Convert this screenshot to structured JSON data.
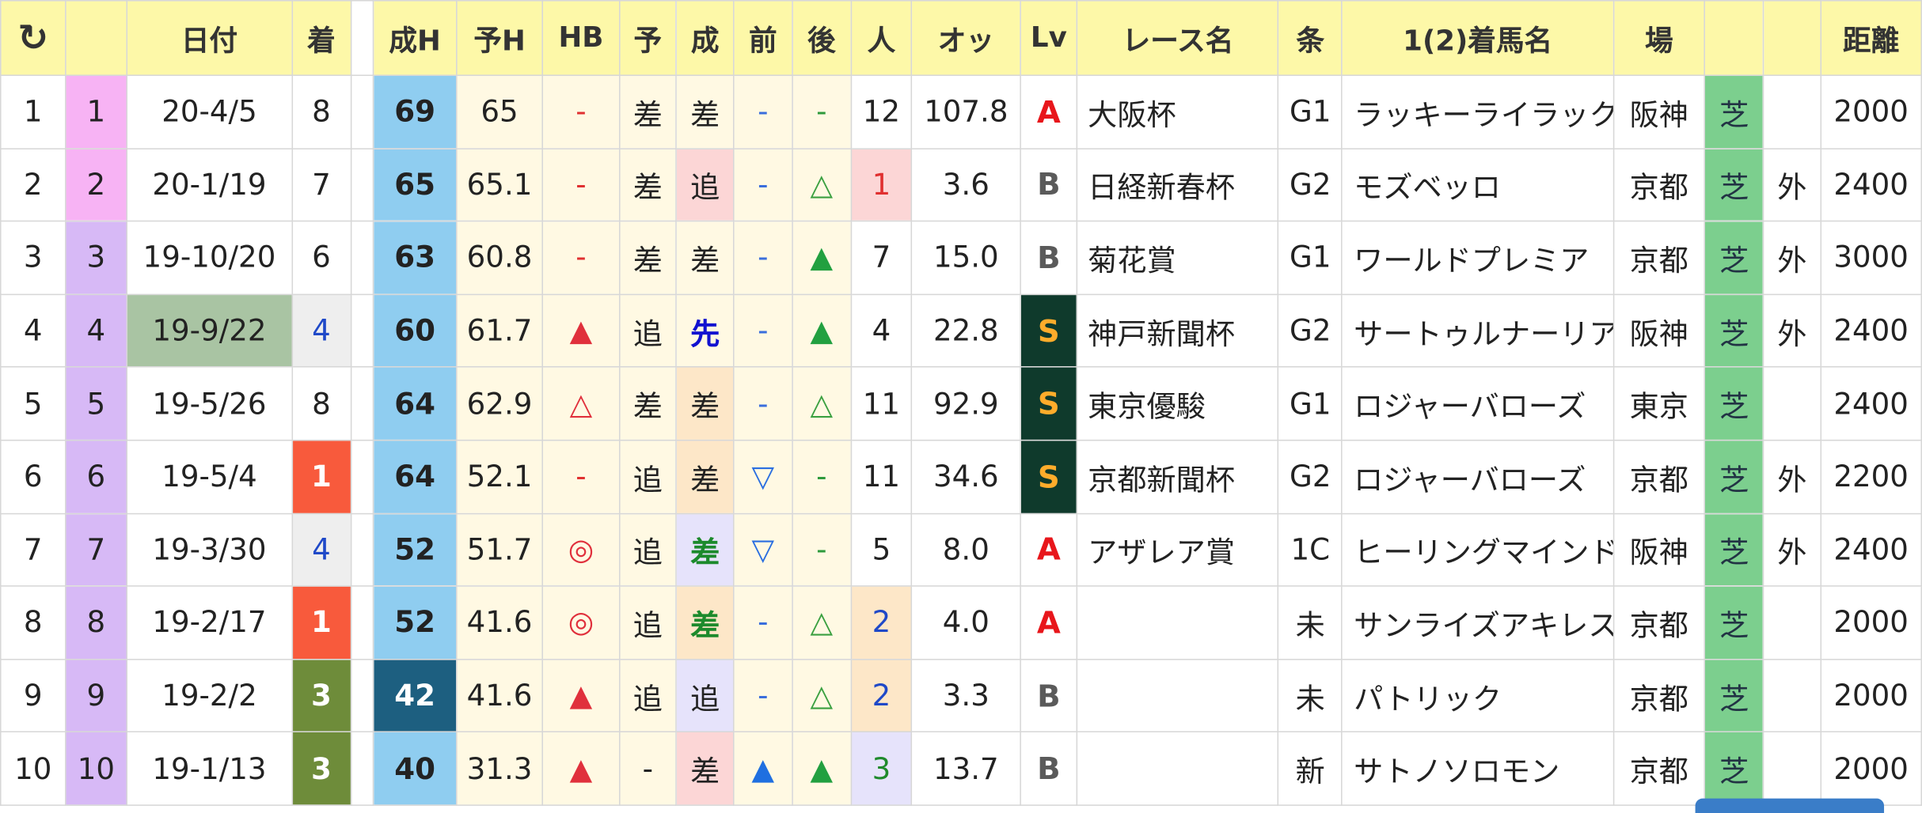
{
  "headers": {
    "refresh_icon": "refresh-icon",
    "date": "日付",
    "finish": "着",
    "actual_h": "成H",
    "pred_h": "予H",
    "hb": "HB",
    "pred_style": "予",
    "actual_style": "成",
    "front": "前",
    "back": "後",
    "popularity": "人",
    "odds": "オッ",
    "lv": "Lv",
    "race_name": "レース名",
    "cond": "条",
    "winner": "1(2)着馬名",
    "venue": "場",
    "distance": "距離"
  },
  "rows": [
    {
      "idx": "1",
      "no": "1",
      "date": "20-4/5",
      "finish": "8",
      "ah": "69",
      "ph": "65",
      "hb": "-",
      "ps": "差",
      "as": "差",
      "fr": "-",
      "bk": "-",
      "pop": "12",
      "odds": "107.8",
      "lv": "A",
      "race": "大阪杯",
      "cond": "G1",
      "horse": "ラッキーライラック",
      "venue": "阪神",
      "surface": "芝",
      "course": "",
      "dist": "2000"
    },
    {
      "idx": "2",
      "no": "2",
      "date": "20-1/19",
      "finish": "7",
      "ah": "65",
      "ph": "65.1",
      "hb": "-",
      "ps": "差",
      "as": "追",
      "fr": "-",
      "bk": "△",
      "pop": "1",
      "odds": "3.6",
      "lv": "B",
      "race": "日経新春杯",
      "cond": "G2",
      "horse": "モズベッロ",
      "venue": "京都",
      "surface": "芝",
      "course": "外",
      "dist": "2400"
    },
    {
      "idx": "3",
      "no": "3",
      "date": "19-10/20",
      "finish": "6",
      "ah": "63",
      "ph": "60.8",
      "hb": "-",
      "ps": "差",
      "as": "差",
      "fr": "-",
      "bk": "▲",
      "pop": "7",
      "odds": "15.0",
      "lv": "B",
      "race": "菊花賞",
      "cond": "G1",
      "horse": "ワールドプレミア",
      "venue": "京都",
      "surface": "芝",
      "course": "外",
      "dist": "3000"
    },
    {
      "idx": "4",
      "no": "4",
      "date": "19-9/22",
      "finish": "4",
      "ah": "60",
      "ph": "61.7",
      "hb": "▲",
      "ps": "追",
      "as": "先",
      "fr": "-",
      "bk": "▲",
      "pop": "4",
      "odds": "22.8",
      "lv": "S",
      "race": "神戸新聞杯",
      "cond": "G2",
      "horse": "サートゥルナーリア",
      "venue": "阪神",
      "surface": "芝",
      "course": "外",
      "dist": "2400"
    },
    {
      "idx": "5",
      "no": "5",
      "date": "19-5/26",
      "finish": "8",
      "ah": "64",
      "ph": "62.9",
      "hb": "△",
      "ps": "差",
      "as": "差",
      "fr": "-",
      "bk": "△",
      "pop": "11",
      "odds": "92.9",
      "lv": "S",
      "race": "東京優駿",
      "cond": "G1",
      "horse": "ロジャーバローズ",
      "venue": "東京",
      "surface": "芝",
      "course": "",
      "dist": "2400"
    },
    {
      "idx": "6",
      "no": "6",
      "date": "19-5/4",
      "finish": "1",
      "ah": "64",
      "ph": "52.1",
      "hb": "-",
      "ps": "追",
      "as": "差",
      "fr": "▽",
      "bk": "-",
      "pop": "11",
      "odds": "34.6",
      "lv": "S",
      "race": "京都新聞杯",
      "cond": "G2",
      "horse": "ロジャーバローズ",
      "venue": "京都",
      "surface": "芝",
      "course": "外",
      "dist": "2200"
    },
    {
      "idx": "7",
      "no": "7",
      "date": "19-3/30",
      "finish": "4",
      "ah": "52",
      "ph": "51.7",
      "hb": "◎",
      "ps": "追",
      "as": "差",
      "fr": "▽",
      "bk": "-",
      "pop": "5",
      "odds": "8.0",
      "lv": "A",
      "race": "アザレア賞",
      "cond": "1C",
      "horse": "ヒーリングマインド",
      "venue": "阪神",
      "surface": "芝",
      "course": "外",
      "dist": "2400"
    },
    {
      "idx": "8",
      "no": "8",
      "date": "19-2/17",
      "finish": "1",
      "ah": "52",
      "ph": "41.6",
      "hb": "◎",
      "ps": "追",
      "as": "差",
      "fr": "-",
      "bk": "△",
      "pop": "2",
      "odds": "4.0",
      "lv": "A",
      "race": "",
      "cond": "未",
      "horse": "サンライズアキレス",
      "venue": "京都",
      "surface": "芝",
      "course": "",
      "dist": "2000"
    },
    {
      "idx": "9",
      "no": "9",
      "date": "19-2/2",
      "finish": "3",
      "ah": "42",
      "ph": "41.6",
      "hb": "▲",
      "ps": "追",
      "as": "追",
      "fr": "-",
      "bk": "△",
      "pop": "2",
      "odds": "3.3",
      "lv": "B",
      "race": "",
      "cond": "未",
      "horse": "パトリック",
      "venue": "京都",
      "surface": "芝",
      "course": "",
      "dist": "2000"
    },
    {
      "idx": "10",
      "no": "10",
      "date": "19-1/13",
      "finish": "3",
      "ah": "40",
      "ph": "31.3",
      "hb": "▲",
      "ps": "-",
      "as": "差",
      "fr": "▲",
      "bk": "▲",
      "pop": "3",
      "odds": "13.7",
      "lv": "B",
      "race": "",
      "cond": "新",
      "horse": "サトノソロモン",
      "venue": "京都",
      "surface": "芝",
      "course": "",
      "dist": "2000"
    }
  ],
  "colors": {
    "header_bg": "#fdf8a8",
    "turf": "#7ccf8e",
    "lv_s_bg": "#0f3a2c",
    "lv_s_text": "#ffac2b",
    "lv_a": "#e8161b"
  }
}
